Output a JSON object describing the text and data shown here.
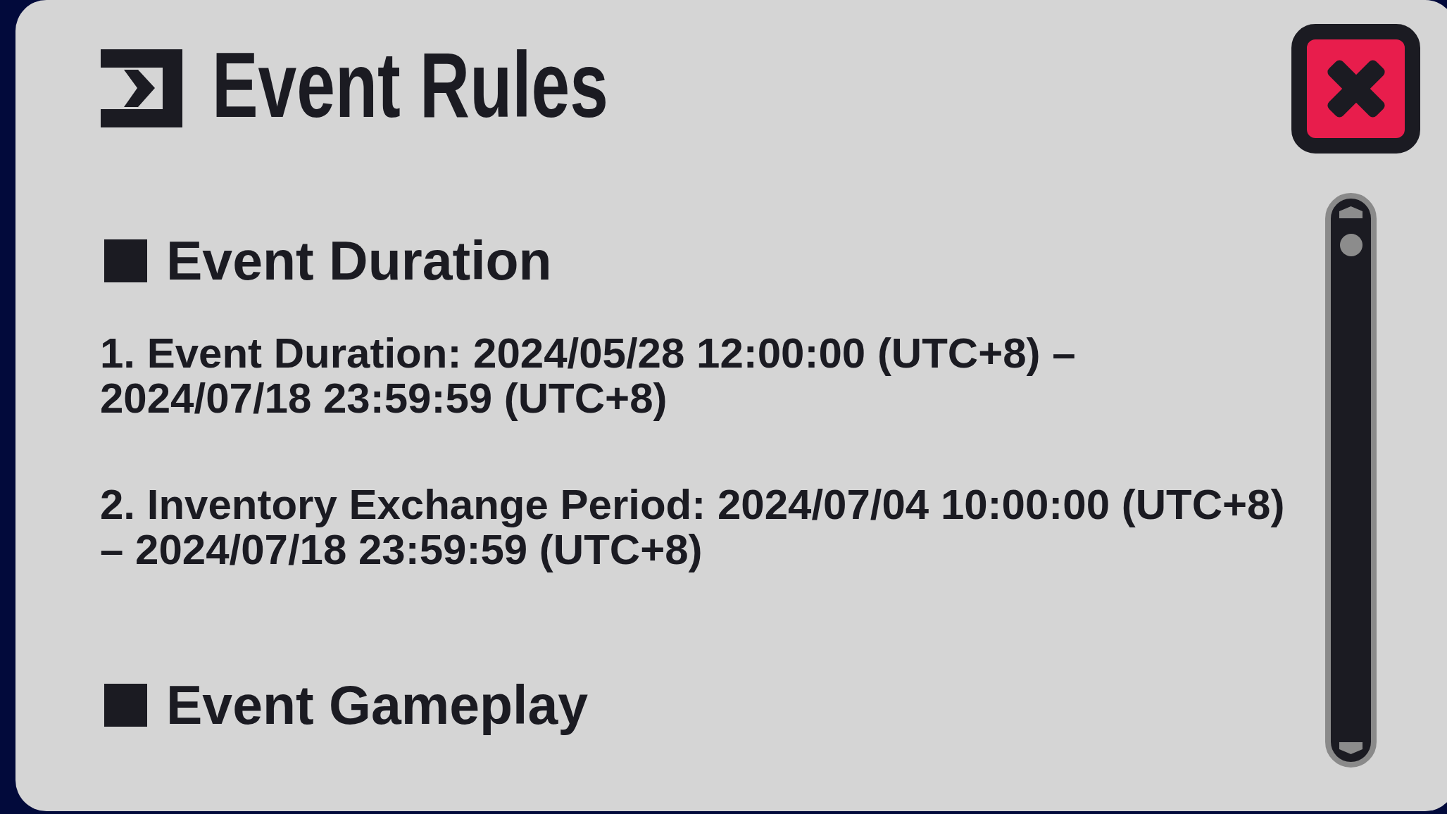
{
  "dialog": {
    "title": "Event Rules"
  },
  "sections": [
    {
      "heading": "Event Duration",
      "paragraphs": [
        "1. Event Duration: 2024/05/28 12:00:00 (UTC+8) – 2024/07/18 23:59:59 (UTC+8)",
        "2. Inventory Exchange Period: 2024/07/04 10:00:00 (UTC+8) – 2024/07/18 23:59:59 (UTC+8)"
      ]
    },
    {
      "heading": "Event Gameplay"
    }
  ]
}
